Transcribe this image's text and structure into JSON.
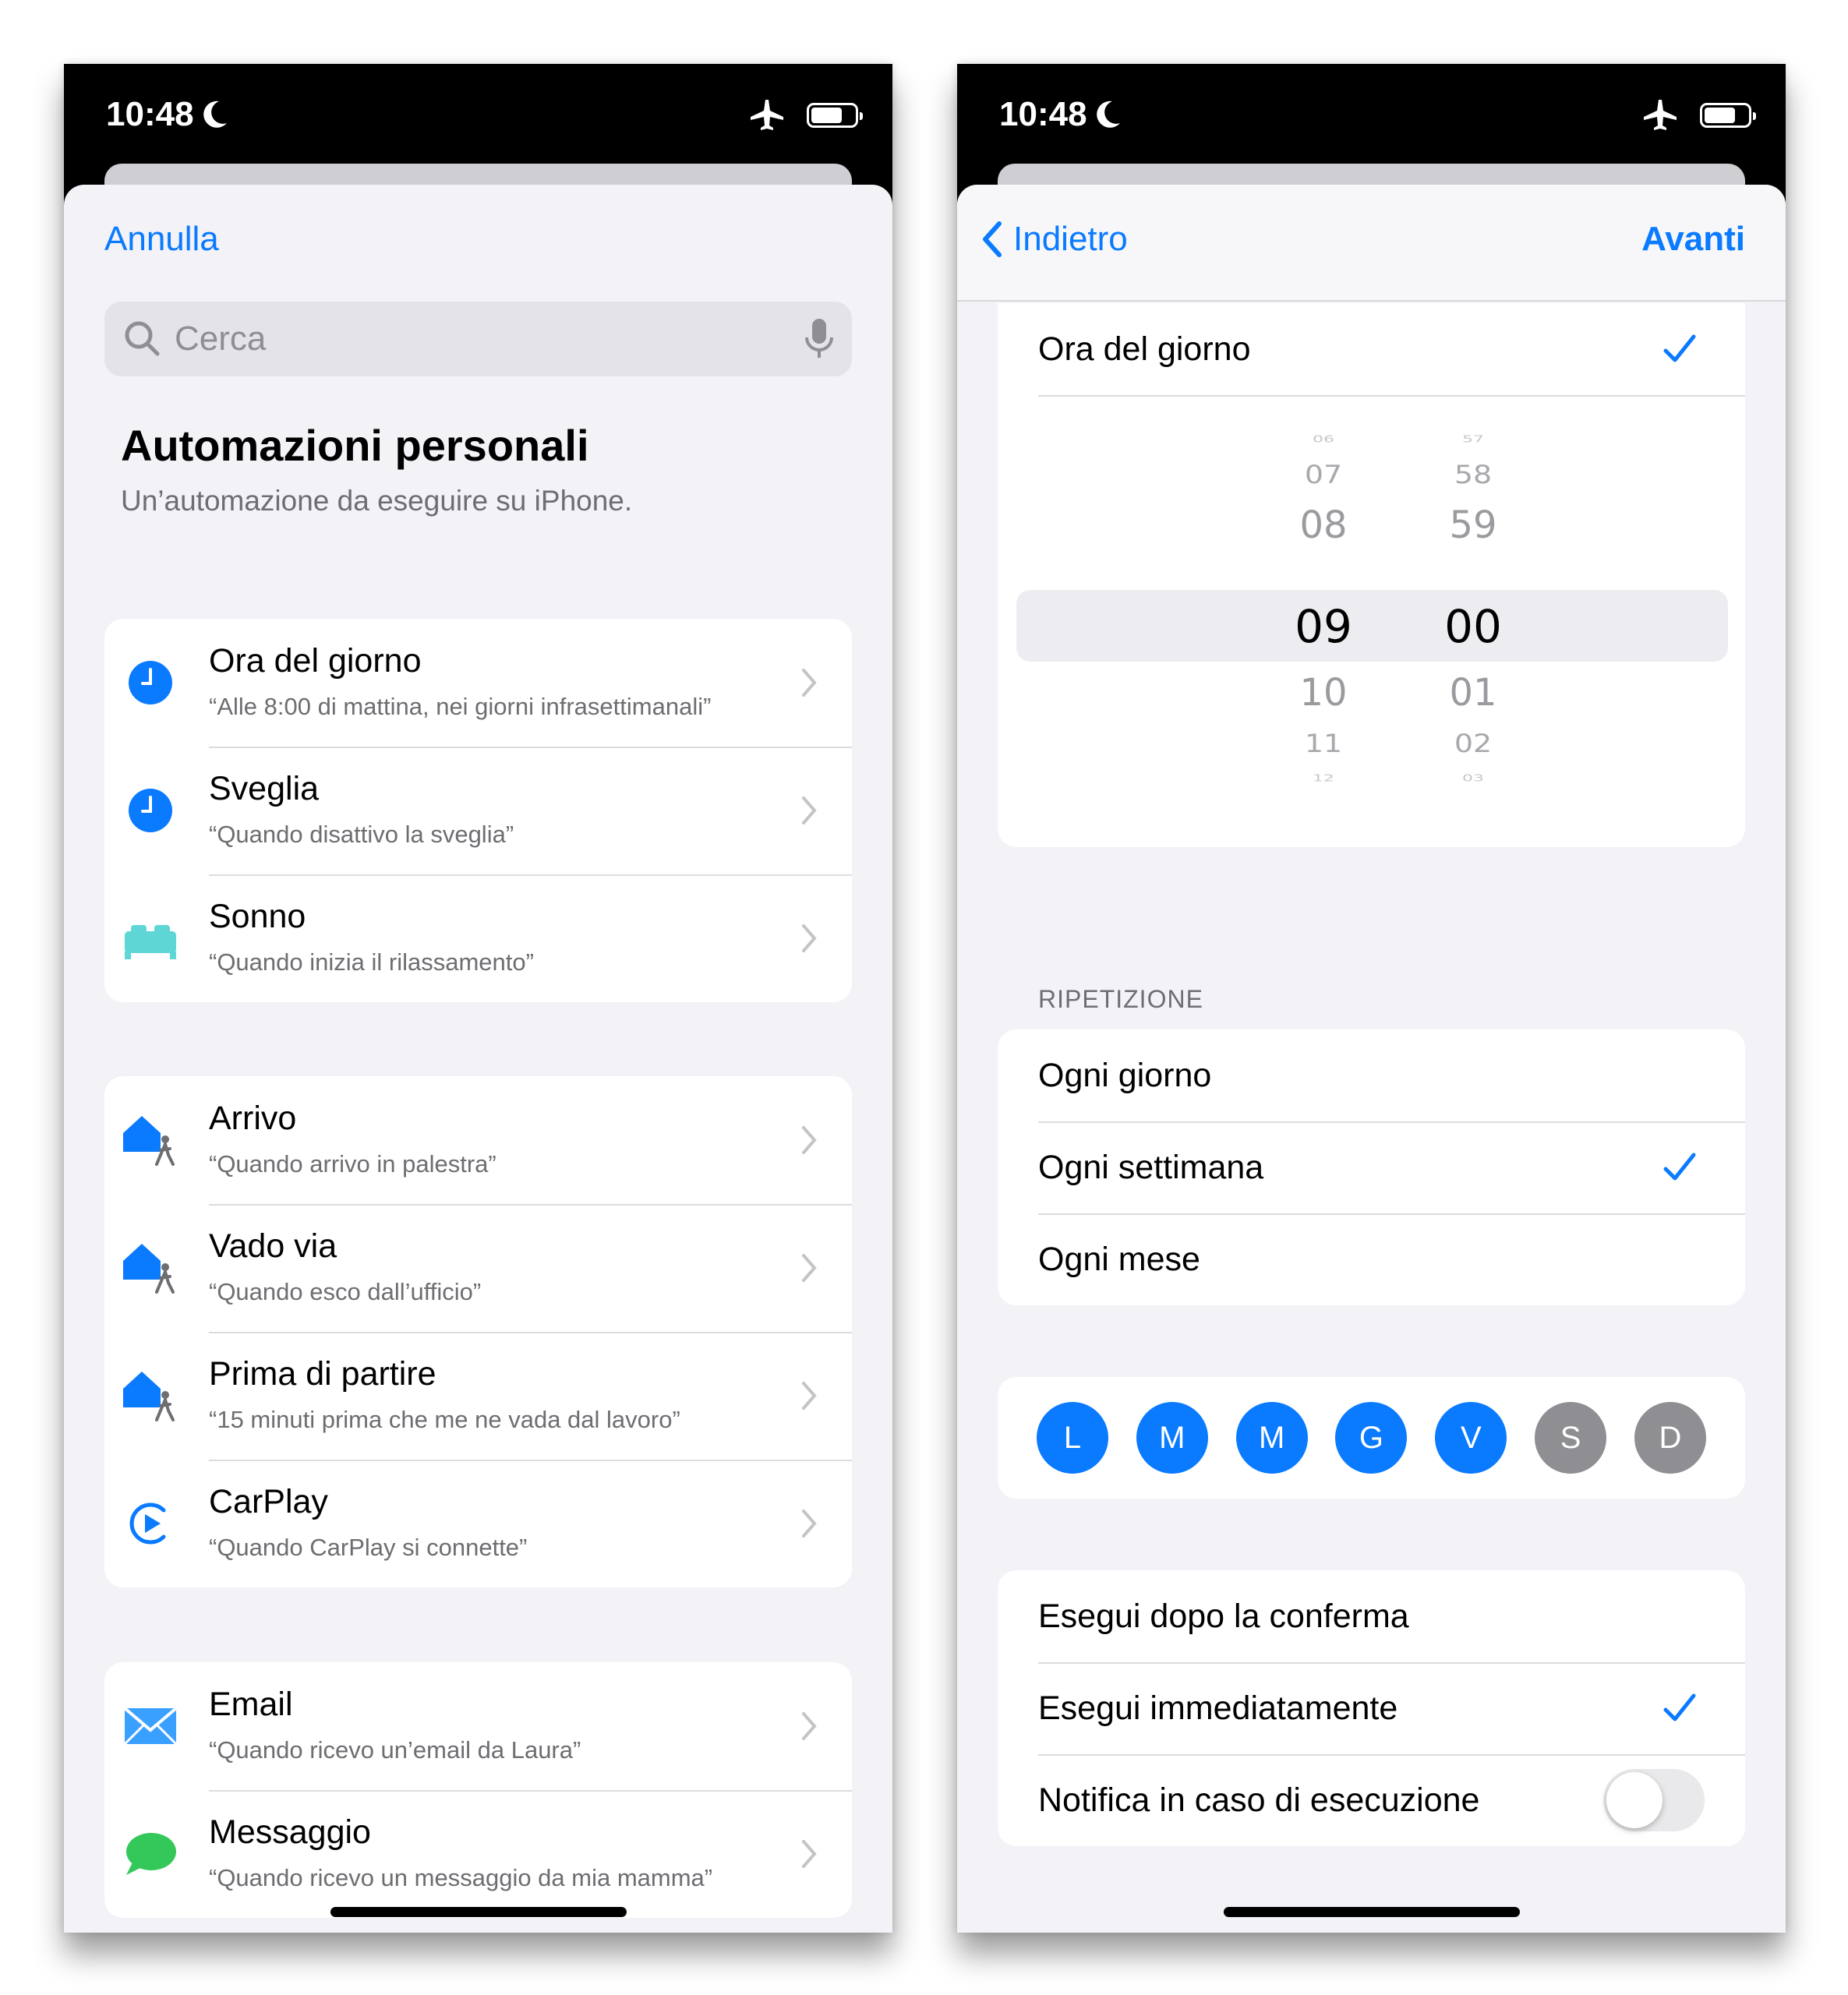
{
  "status": {
    "time": "10:48"
  },
  "left": {
    "cancel": "Annulla",
    "search_placeholder": "Cerca",
    "title": "Automazioni personali",
    "subtitle": "Un’automazione da eseguire su iPhone.",
    "groups": [
      [
        {
          "title": "Ora del giorno",
          "subtitle": "“Alle 8:00 di mattina, nei giorni infrasettimanali”",
          "icon": "clock-icon"
        },
        {
          "title": "Sveglia",
          "subtitle": "“Quando disattivo la sveglia”",
          "icon": "alarm-clock-icon"
        },
        {
          "title": "Sonno",
          "subtitle": "“Quando inizia il rilassamento”",
          "icon": "bed-icon"
        }
      ],
      [
        {
          "title": "Arrivo",
          "subtitle": "“Quando arrivo in palestra”",
          "icon": "house-arrive-icon"
        },
        {
          "title": "Vado via",
          "subtitle": "“Quando esco dall’ufficio”",
          "icon": "house-leave-icon"
        },
        {
          "title": "Prima di partire",
          "subtitle": "“15 minuti prima che me ne vada dal lavoro”",
          "icon": "house-before-icon"
        },
        {
          "title": "CarPlay",
          "subtitle": "“Quando CarPlay si connette”",
          "icon": "carplay-icon"
        }
      ],
      [
        {
          "title": "Email",
          "subtitle": "“Quando ricevo un’email da Laura”",
          "icon": "mail-icon"
        },
        {
          "title": "Messaggio",
          "subtitle": "“Quando ricevo un messaggio da mia mamma”",
          "icon": "message-icon"
        }
      ]
    ]
  },
  "right": {
    "back": "Indietro",
    "next": "Avanti",
    "time_option": "Ora del giorno",
    "picker": {
      "hours": [
        "06",
        "07",
        "08",
        "09",
        "10",
        "11",
        "12"
      ],
      "minutes": [
        "57",
        "58",
        "59",
        "00",
        "01",
        "02",
        "03"
      ]
    },
    "repeat_label": "RIPETIZIONE",
    "repeat_options": [
      "Ogni giorno",
      "Ogni settimana",
      "Ogni mese"
    ],
    "selected_repeat": "Ogni settimana",
    "days": [
      {
        "label": "L",
        "on": true
      },
      {
        "label": "M",
        "on": true
      },
      {
        "label": "M",
        "on": true
      },
      {
        "label": "G",
        "on": true
      },
      {
        "label": "V",
        "on": true
      },
      {
        "label": "S",
        "on": false
      },
      {
        "label": "D",
        "on": false
      }
    ],
    "run_options": [
      "Esegui dopo la conferma",
      "Esegui immediatamente"
    ],
    "selected_run": "Esegui immediatamente",
    "notify_label": "Notifica in caso di esecuzione",
    "notify_on": false
  },
  "colors": {
    "accent": "#0a7aff",
    "day_off": "#8e8e93",
    "background": "#f2f2f7"
  }
}
